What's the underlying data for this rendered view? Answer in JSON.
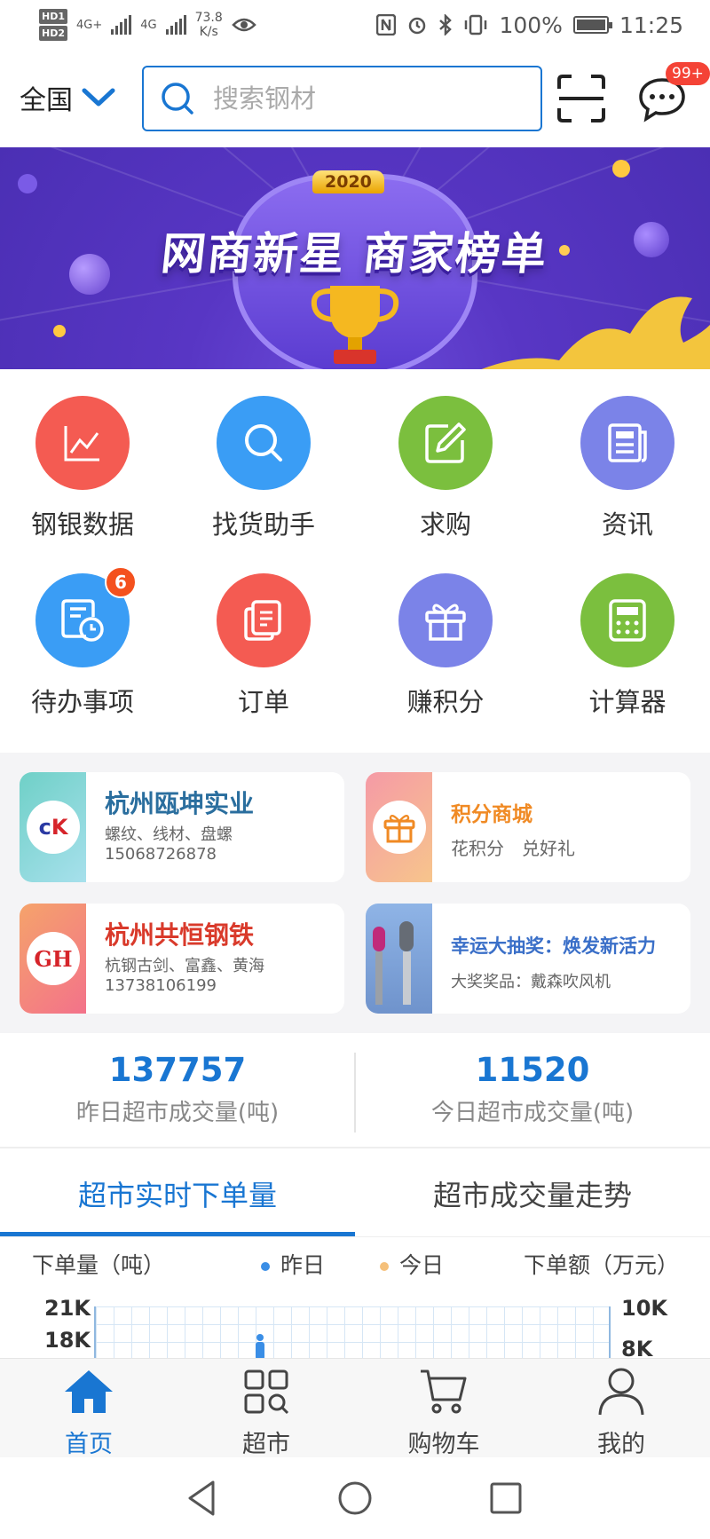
{
  "status_bar": {
    "hd1": "HD1",
    "hd2": "HD2",
    "net1": "4G+",
    "net2": "4G",
    "speed_value": "73.8",
    "speed_unit": "K/s",
    "nfc_icon": "nfc-icon",
    "battery": "100%",
    "time": "11:25"
  },
  "header": {
    "region": "全国",
    "search_placeholder": "搜索钢材",
    "message_badge": "99+"
  },
  "banner": {
    "year": "2020",
    "title": "网商新星 商家榜单"
  },
  "grid": [
    {
      "label": "钢银数据",
      "icon": "chart-icon",
      "color": "#f45b52"
    },
    {
      "label": "找货助手",
      "icon": "search-icon",
      "color": "#3a9df5"
    },
    {
      "label": "求购",
      "icon": "edit-icon",
      "color": "#7bbf3e"
    },
    {
      "label": "资讯",
      "icon": "news-icon",
      "color": "#7b83e8"
    },
    {
      "label": "待办事项",
      "icon": "todo-icon",
      "color": "#3a9df5",
      "badge": "6"
    },
    {
      "label": "订单",
      "icon": "document-icon",
      "color": "#f45b52"
    },
    {
      "label": "赚积分",
      "icon": "gift-icon",
      "color": "#7b83e8"
    },
    {
      "label": "计算器",
      "icon": "calculator-icon",
      "color": "#7bbf3e"
    }
  ],
  "promos": [
    {
      "title": "杭州瓯坤实业",
      "line1": "螺纹、线材、盘螺",
      "line2": "15068726878",
      "logo": "CK",
      "title_color": "#2a6e9e"
    },
    {
      "title": "积分商城",
      "line1": "花积分　兑好礼",
      "logo": "gift-icon",
      "title_color": "#f08a24"
    },
    {
      "title": "杭州共恒钢铁",
      "line1": "杭钢古剑、富鑫、黄海",
      "line2": "13738106199",
      "logo": "GH",
      "title_color": "#d93a2b"
    },
    {
      "title": "幸运大抽奖：焕发新活力",
      "line1": "大奖奖品：戴森吹风机",
      "logo": "hairdryer-icon",
      "title_color": "#3a6fc8"
    }
  ],
  "stats": [
    {
      "value": "137757",
      "caption": "昨日超市成交量(吨)"
    },
    {
      "value": "11520",
      "caption": "今日超市成交量(吨)"
    }
  ],
  "tabs": [
    {
      "label": "超市实时下单量",
      "active": true
    },
    {
      "label": "超市成交量走势",
      "active": false
    }
  ],
  "chart_preview": {
    "left_axis": "下单量（吨）",
    "right_axis": "下单额（万元）",
    "legend_yesterday": "昨日",
    "legend_today": "今日",
    "y_left_ticks": [
      "21K",
      "18K"
    ],
    "y_right_ticks": [
      "10K",
      "8K"
    ],
    "colors": {
      "yesterday": "#3a8ee6",
      "today": "#f5c07a"
    }
  },
  "bottom_nav": [
    {
      "label": "首页",
      "icon": "home-icon",
      "active": true
    },
    {
      "label": "超市",
      "icon": "market-icon",
      "active": false
    },
    {
      "label": "购物车",
      "icon": "cart-icon",
      "active": false
    },
    {
      "label": "我的",
      "icon": "user-icon",
      "active": false
    }
  ]
}
